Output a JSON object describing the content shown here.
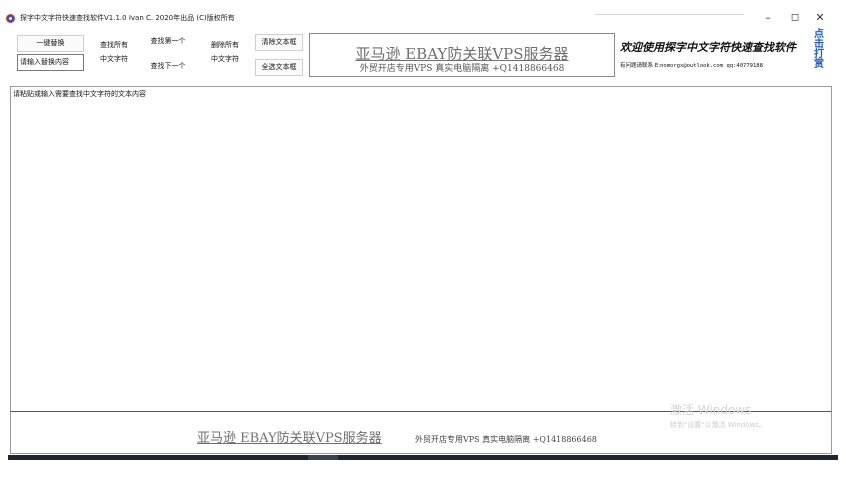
{
  "window": {
    "title": "探字中文字符快速查找软件V1.1.0   Ivan C. 2020年出品 (C)版权所有",
    "minimize": "–",
    "maximize": "◻",
    "close": "✕"
  },
  "toolbar": {
    "replace_all": "一键替换",
    "find_all": "查找所有",
    "find_all_chinese": "中文字符",
    "find_first": "查找第一个",
    "find_next": "查找下一个",
    "delete_all": "删除所有",
    "delete_all_chinese": "中文字符",
    "clear_text": "清除文本框",
    "select_all_text": "全选文本框",
    "replace_input_placeholder": "请输入替换内容"
  },
  "banner": {
    "title": "亚马逊  EBAY防关联VPS服务器",
    "subtitle": "外贸开店专用VPS  真实电脑隔离  +Q1418866468"
  },
  "info": {
    "welcome": "欢迎使用探字中文字符快速查找软件",
    "contact_label": "有问题请联系 E:",
    "contact_email": "nomorgx@outlook.com",
    "contact_qq": "qq:40779188",
    "vertical_link": "点击打赏"
  },
  "editor": {
    "placeholder": "请粘贴或输入需要查找中文字符的文本内容"
  },
  "footer": {
    "title": "亚马逊  EBAY防关联VPS服务器",
    "subtitle": "外贸开店专用VPS  真实电脑隔离  +Q1418866468"
  },
  "watermark": {
    "line1": "激活 Windows",
    "line2": "转到\"设置\"以激活 Windows。"
  }
}
